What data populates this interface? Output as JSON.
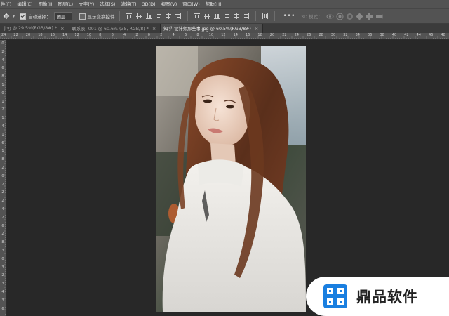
{
  "menubar": {
    "items": [
      "件(F)",
      "编辑(E)",
      "图像(I)",
      "图层(L)",
      "文字(Y)",
      "选择(S)",
      "滤镜(T)",
      "3D(D)",
      "视图(V)",
      "窗口(W)",
      "帮助(H)"
    ]
  },
  "options_bar": {
    "auto_select_label": "自动选择：",
    "auto_select_checked": true,
    "auto_select_target": "图层",
    "show_transform_label": "显示变换控件",
    "show_transform_checked": false,
    "more_label": "•••",
    "mode_3d_label": "3D 模式："
  },
  "tabs": [
    {
      "label": ".jpg @ 29.5%(RGB/8#) *",
      "active": false
    },
    {
      "label": "联系表 -001 @ 60.6% (35, RGB/8) *",
      "active": false
    },
    {
      "label": "知乎-设计师那些事.jpg @ 60.5%(RGB/8#)",
      "active": true
    }
  ],
  "ruler": {
    "top_numbers": [
      "24",
      "22",
      "20",
      "18",
      "16",
      "14",
      "12",
      "10",
      "8",
      "6",
      "4",
      "2",
      "0",
      "2",
      "4",
      "6",
      "8",
      "10",
      "12",
      "14",
      "16",
      "18",
      "20",
      "22",
      "24",
      "26",
      "28",
      "30",
      "32",
      "34",
      "36",
      "38",
      "40",
      "42",
      "44",
      "46",
      "48"
    ],
    "left_numbers": [
      "0",
      "2",
      "4",
      "6",
      "8",
      "1",
      "0",
      "1",
      "2",
      "1",
      "4",
      "1",
      "6",
      "1",
      "8",
      "2",
      "0",
      "2",
      "2",
      "2",
      "4",
      "2",
      "6",
      "2",
      "8",
      "3",
      "0",
      "3",
      "2",
      "3",
      "4",
      "3",
      "6"
    ]
  },
  "document": {
    "image_desc_name": "portrait-photo"
  },
  "watermark": {
    "text": "鼎品软件",
    "brand_color": "#1a7fe0"
  },
  "colors": {
    "ui_panel": "#535353",
    "workspace": "#282828",
    "tab_inactive": "#3b3b3b",
    "tab_active": "#4f4f4f"
  }
}
